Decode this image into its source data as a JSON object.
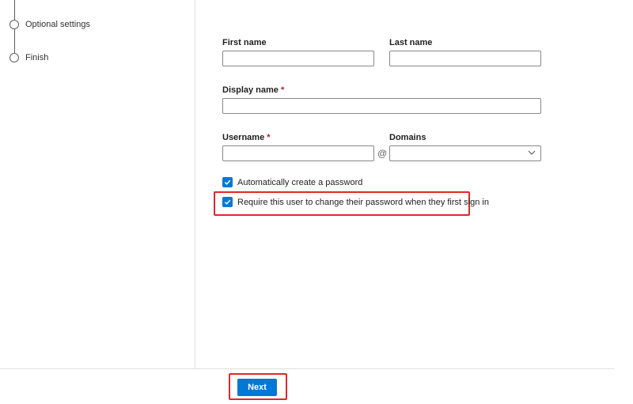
{
  "wizard_steps": [
    {
      "label": "Optional settings",
      "state": "pending"
    },
    {
      "label": "Finish",
      "state": "pending"
    }
  ],
  "form": {
    "first_name_label": "First name",
    "last_name_label": "Last name",
    "display_name_label": "Display name",
    "username_label": "Username",
    "domains_label": "Domains",
    "required_mark": "*",
    "first_name_value": "",
    "last_name_value": "",
    "display_name_value": "",
    "username_value": "",
    "at_symbol": "@",
    "domain_value": "",
    "auto_password_label": "Automatically create a password",
    "auto_password_checked": true,
    "require_change_label": "Require this user to change their password when they first sign in",
    "require_change_checked": true
  },
  "footer": {
    "next_label": "Next"
  },
  "colors": {
    "accent": "#0078d4",
    "highlight_border": "#e3262c",
    "required": "#a4262c"
  }
}
